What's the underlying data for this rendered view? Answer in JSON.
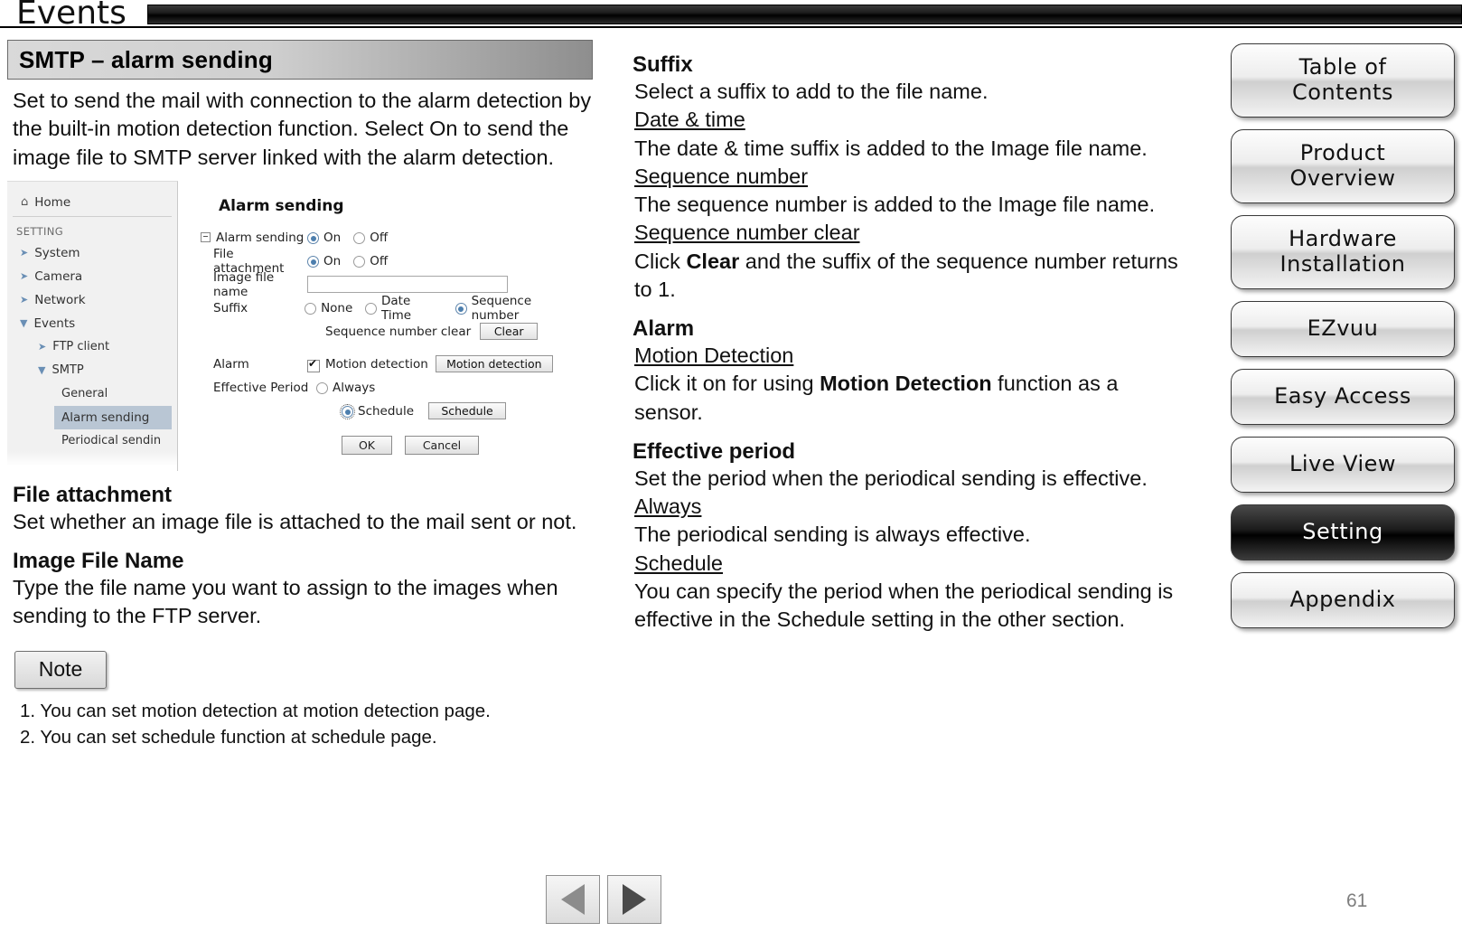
{
  "header": {
    "tab_title": "Events"
  },
  "section": {
    "banner_title": "SMTP – alarm sending",
    "intro": "Set to send the mail with connection to the alarm detection by the built-in motion detection function. Select On to send the image file to SMTP server linked with the alarm detection."
  },
  "ui_mock": {
    "nav": {
      "home": "Home",
      "setting_label": "SETTING",
      "items": [
        {
          "label": "System",
          "level": 1
        },
        {
          "label": "Camera",
          "level": 1
        },
        {
          "label": "Network",
          "level": 1
        },
        {
          "label": "Events",
          "level": 1
        },
        {
          "label": "FTP client",
          "level": 2
        },
        {
          "label": "SMTP",
          "level": 2
        },
        {
          "label": "General",
          "level": 3
        },
        {
          "label": "Alarm sending",
          "level": 3
        },
        {
          "label": "Periodical sendin",
          "level": 3
        }
      ]
    },
    "form": {
      "title": "Alarm sending",
      "alarm_sending_label": "Alarm sending",
      "alarm_sending_on": "On",
      "alarm_sending_off": "Off",
      "file_attachment_label": "File attachment",
      "file_attachment_on": "On",
      "file_attachment_off": "Off",
      "image_file_name_label": "Image file name",
      "image_file_name_value": "",
      "suffix_label": "Suffix",
      "suffix_none": "None",
      "suffix_date_time": "Date Time",
      "suffix_sequence_number": "Sequence number",
      "sequence_number_clear_label": "Sequence number clear",
      "clear_button": "Clear",
      "alarm_label": "Alarm",
      "motion_detection_check": "Motion detection",
      "motion_detection_button": "Motion detection",
      "effective_period_label": "Effective Period",
      "always_label": "Always",
      "schedule_label": "Schedule",
      "schedule_button": "Schedule",
      "ok_button": "OK",
      "cancel_button": "Cancel"
    }
  },
  "left_text": {
    "file_attachment_heading": "File attachment",
    "file_attachment_body": "Set whether an image file is attached to the mail sent or not.",
    "image_file_name_heading": "Image File Name",
    "image_file_name_body": "Type the file name you want to assign to the images when sending to the FTP server."
  },
  "note": {
    "label": "Note",
    "items": [
      "1. You can set motion detection at motion detection page.",
      "2. You can set schedule function at schedule page."
    ]
  },
  "mid_text": {
    "suffix_heading": "Suffix",
    "suffix_body": "Select a suffix to add to the file name.",
    "date_time_sub": "Date & time",
    "date_time_body": "The date & time suffix is added to the Image file name.",
    "sequence_number_sub": "Sequence number",
    "sequence_number_body": "The sequence number is added to the Image file name.",
    "sequence_number_clear_sub": "Sequence number clear",
    "sequence_number_clear_body_pre": "Click ",
    "sequence_number_clear_bold": "Clear",
    "sequence_number_clear_body_post": " and the suffix of the sequence number returns to 1.",
    "alarm_heading": "Alarm",
    "motion_detection_sub": "Motion Detection",
    "motion_detection_body_pre": "Click it on for using ",
    "motion_detection_bold": "Motion Detection",
    "motion_detection_body_post": " function as a sensor.",
    "effective_period_heading": "Effective period",
    "effective_period_body": "Set the period when the periodical sending is effective.",
    "always_sub": "Always",
    "always_body": "The periodical sending is always effective.",
    "schedule_sub": "Schedule",
    "schedule_body": "You can specify the period when the periodical sending is effective in the Schedule setting in the other section."
  },
  "right_nav": {
    "buttons": [
      {
        "label_line1": "Table of",
        "label_line2": "Contents",
        "active": false
      },
      {
        "label_line1": "Product",
        "label_line2": "Overview",
        "active": false
      },
      {
        "label_line1": "Hardware",
        "label_line2": "Installation",
        "active": false
      },
      {
        "label_line1": "EZvuu",
        "label_line2": "",
        "active": false
      },
      {
        "label_line1": "Easy Access",
        "label_line2": "",
        "active": false
      },
      {
        "label_line1": "Live View",
        "label_line2": "",
        "active": false
      },
      {
        "label_line1": "Setting",
        "label_line2": "",
        "active": true
      },
      {
        "label_line1": "Appendix",
        "label_line2": "",
        "active": false
      }
    ]
  },
  "footer": {
    "prev_icon": "triangle-left-icon",
    "next_icon": "triangle-right-icon",
    "page_number": "61"
  }
}
